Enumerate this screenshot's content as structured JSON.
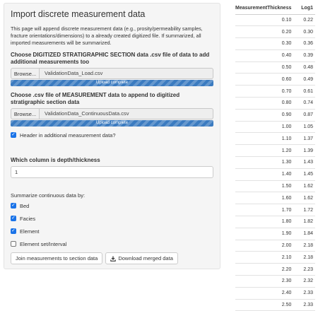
{
  "panel": {
    "title": "Import discrete measurement data",
    "description": "This page will append discrete measurement data (e.g., prosity/permeability samples, fracture orientations/dimensions) to a already created digitized file. If summarized, all imported measurements will be summarized.",
    "file1": {
      "label": "Choose DIGITIZED STRATIGRAPHIC SECTION data .csv file of data to add additional measurements too",
      "browse": "Browse...",
      "filename": "ValidationData_Load.csv",
      "progress": "Upload complete",
      "progress_fraction": 1.0
    },
    "file2": {
      "label": "Choose .csv file of MEASUREMENT data to append to digitized stratigraphic section data",
      "browse": "Browse...",
      "filename": "ValidationData_ContinuousData.csv",
      "progress": "Upload complete",
      "progress_fraction": 1.0
    },
    "header_check": {
      "label": "Header in additional measurement data?",
      "checked": true
    },
    "depth_column": {
      "label": "Which column is depth/thickness",
      "value": "1"
    },
    "summarize": {
      "label": "Summarize continuous data by:",
      "options": [
        {
          "label": "Bed",
          "checked": true
        },
        {
          "label": "Facies",
          "checked": true
        },
        {
          "label": "Element",
          "checked": true
        },
        {
          "label": "Element set/Interval",
          "checked": false
        }
      ]
    },
    "buttons": {
      "join": "Join measurements to section data",
      "download": "Download merged data"
    }
  },
  "table": {
    "columns": [
      "MeasurementThickness",
      "Log1"
    ],
    "rows": [
      [
        "0.10",
        "0.22"
      ],
      [
        "0.20",
        "0.30"
      ],
      [
        "0.30",
        "0.36"
      ],
      [
        "0.40",
        "0.39"
      ],
      [
        "0.50",
        "0.48"
      ],
      [
        "0.60",
        "0.49"
      ],
      [
        "0.70",
        "0.61"
      ],
      [
        "0.80",
        "0.74"
      ],
      [
        "0.90",
        "0.87"
      ],
      [
        "1.00",
        "1.05"
      ],
      [
        "1.10",
        "1.37"
      ],
      [
        "1.20",
        "1.39"
      ],
      [
        "1.30",
        "1.43"
      ],
      [
        "1.40",
        "1.45"
      ],
      [
        "1.50",
        "1.62"
      ],
      [
        "1.60",
        "1.62"
      ],
      [
        "1.70",
        "1.72"
      ],
      [
        "1.80",
        "1.82"
      ],
      [
        "1.90",
        "1.84"
      ],
      [
        "2.00",
        "2.18"
      ],
      [
        "2.10",
        "2.18"
      ],
      [
        "2.20",
        "2.23"
      ],
      [
        "2.30",
        "2.32"
      ],
      [
        "2.40",
        "2.33"
      ],
      [
        "2.50",
        "2.33"
      ]
    ]
  }
}
